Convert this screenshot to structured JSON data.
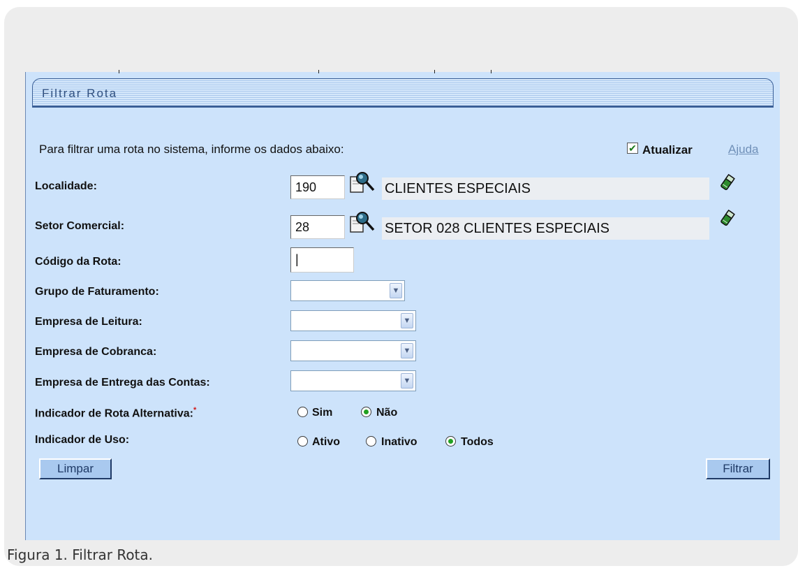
{
  "window": {
    "title": "Filtrar Rota"
  },
  "intro_text": "Para filtrar uma rota no sistema, informe os dados abaixo:",
  "atualizar": {
    "label": "Atualizar",
    "checked": true
  },
  "ajuda_label": "Ajuda",
  "fields": {
    "localidade": {
      "label": "Localidade:",
      "code": "190",
      "name": "CLIENTES ESPECIAIS"
    },
    "setor_comercial": {
      "label": "Setor Comercial:",
      "code": "28",
      "name": "SETOR 028 CLIENTES ESPECIAIS"
    },
    "codigo_rota": {
      "label": "Código da Rota:",
      "value": "|"
    },
    "grupo_faturamento": {
      "label": "Grupo de Faturamento:",
      "selected": ""
    },
    "empresa_leitura": {
      "label": "Empresa de Leitura:",
      "selected": ""
    },
    "empresa_cobranca": {
      "label": "Empresa de Cobranca:",
      "selected": ""
    },
    "empresa_entrega": {
      "label": "Empresa de Entrega das Contas:",
      "selected": ""
    },
    "indicador_rota_alternativa": {
      "label": "Indicador de Rota Alternativa:",
      "required_mark": "*",
      "options": [
        "Sim",
        "Não"
      ],
      "selected": "Não"
    },
    "indicador_uso": {
      "label": "Indicador de Uso:",
      "options": [
        "Ativo",
        "Inativo",
        "Todos"
      ],
      "selected": "Todos"
    }
  },
  "buttons": {
    "limpar": "Limpar",
    "filtrar": "Filtrar"
  },
  "icons": {
    "lookup": "magnifier-lookup-icon",
    "clear": "eraser-icon"
  },
  "caption": "Figura 1. Filtrar Rota."
}
